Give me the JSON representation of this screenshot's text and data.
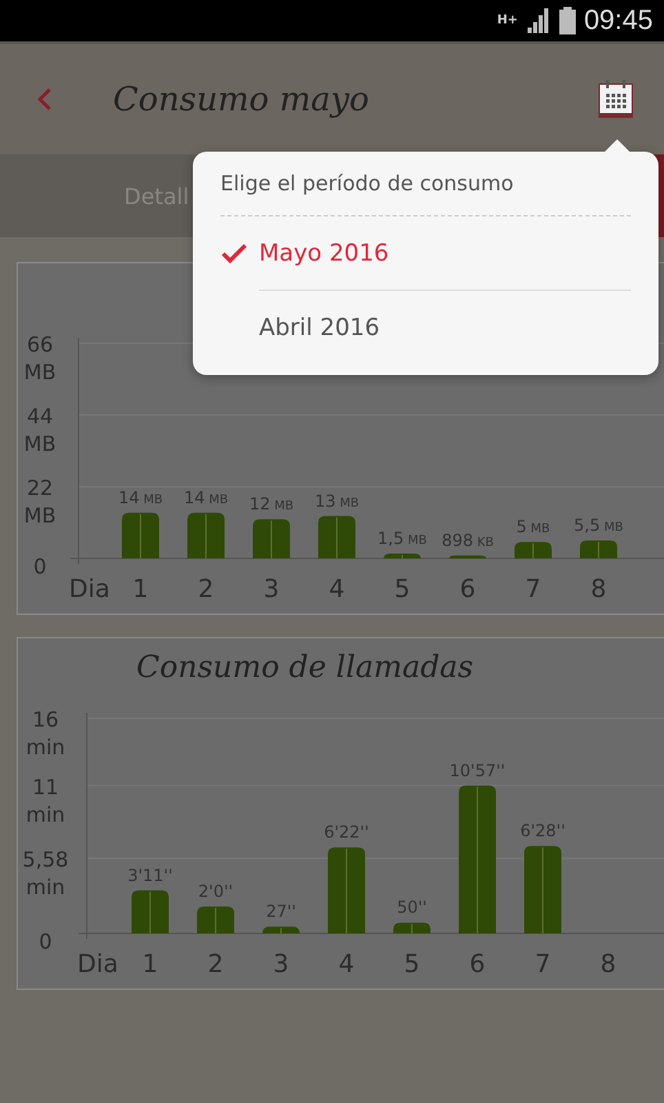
{
  "status_bar": {
    "network": "H+",
    "time": "09:45"
  },
  "app_bar": {
    "title": "Consumo mayo"
  },
  "tabs": [
    {
      "label": "Detall",
      "selected": false
    },
    {
      "selected": true
    }
  ],
  "charts": [
    {
      "chart_data": {
        "type": "bar",
        "xlabel": "Dia",
        "categories": [
          "1",
          "2",
          "3",
          "4",
          "5",
          "6",
          "7",
          "8"
        ],
        "values": [
          14,
          14,
          12,
          13,
          1.5,
          0.9,
          5,
          5.5
        ],
        "ylim": [
          0,
          66
        ],
        "yticks": [
          {
            "value": 0,
            "label": "0"
          },
          {
            "value": 22,
            "label": "22 MB"
          },
          {
            "value": 44,
            "label": "44 MB"
          },
          {
            "value": 66,
            "label": "66 MB"
          }
        ],
        "annotations": [
          "14 MB",
          "14 MB",
          "12 MB",
          "13 MB",
          "1,5 MB",
          "898 KB",
          "5 MB",
          "5,5 MB"
        ]
      }
    },
    {
      "title": "Consumo de llamadas",
      "chart_data": {
        "type": "bar",
        "xlabel": "Dia",
        "categories": [
          "1",
          "2",
          "3",
          "4",
          "5",
          "6",
          "7",
          "8"
        ],
        "values": [
          3.2,
          2,
          0.5,
          6.4,
          0.8,
          11,
          6.5,
          0
        ],
        "ylim": [
          0,
          16
        ],
        "yticks": [
          {
            "value": 0,
            "label": "0"
          },
          {
            "value": 5.58,
            "label": "5,58 min"
          },
          {
            "value": 11,
            "label": "11 min"
          },
          {
            "value": 16,
            "label": "16 min"
          }
        ],
        "annotations": [
          "3'11''",
          "2'0''",
          "27''",
          "6'22''",
          "50''",
          "10'57''",
          "6'28''"
        ]
      }
    }
  ],
  "period_menu": {
    "header": "Elige el período de consumo",
    "items": [
      {
        "label": "Mayo 2016",
        "selected": true
      },
      {
        "label": "Abril 2016",
        "selected": false
      }
    ]
  }
}
